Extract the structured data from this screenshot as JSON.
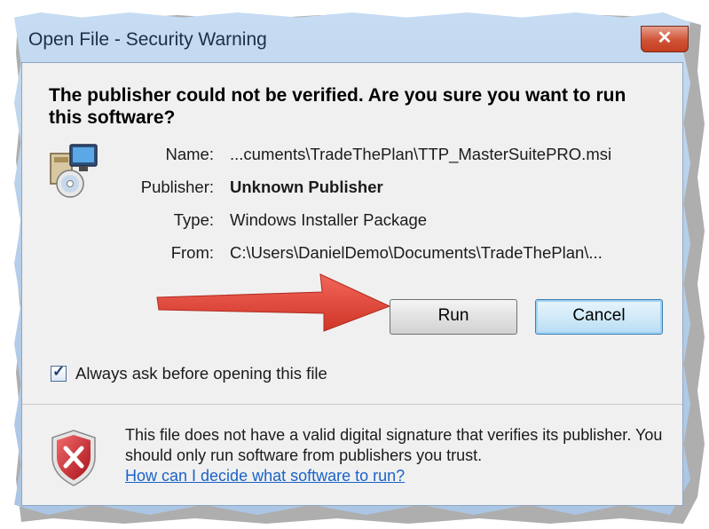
{
  "dialog": {
    "title": "Open File - Security Warning",
    "close_glyph": "✕",
    "question": "The publisher could not be verified.  Are you sure you want to run this software?"
  },
  "fields": [
    {
      "label": "Name:",
      "value": "...cuments\\TradeThePlan\\TTP_MasterSuitePRO.msi",
      "bold": false
    },
    {
      "label": "Publisher:",
      "value": "Unknown Publisher",
      "bold": true
    },
    {
      "label": "Type:",
      "value": "Windows Installer Package",
      "bold": false
    },
    {
      "label": "From:",
      "value": "C:\\Users\\DanielDemo\\Documents\\TradeThePlan\\...",
      "bold": false
    }
  ],
  "buttons": {
    "run_label": "Run",
    "cancel_label": "Cancel"
  },
  "checkbox": {
    "label": "Always ask before opening this file",
    "checked": true,
    "tick": "✓"
  },
  "footer": {
    "warning_text": "This file does not have a valid digital signature that verifies its publisher.  You should only run software from publishers you trust.",
    "help_link": "How can I decide what software to run?"
  },
  "icons": {
    "package": "installer-package-icon",
    "shield": "security-shield-icon",
    "arrow": "red-arrow-annotation"
  },
  "colors": {
    "arrow": "#e0463a",
    "link": "#1a63c8",
    "close_button": "#c53d20",
    "shield": "#c8232c"
  }
}
